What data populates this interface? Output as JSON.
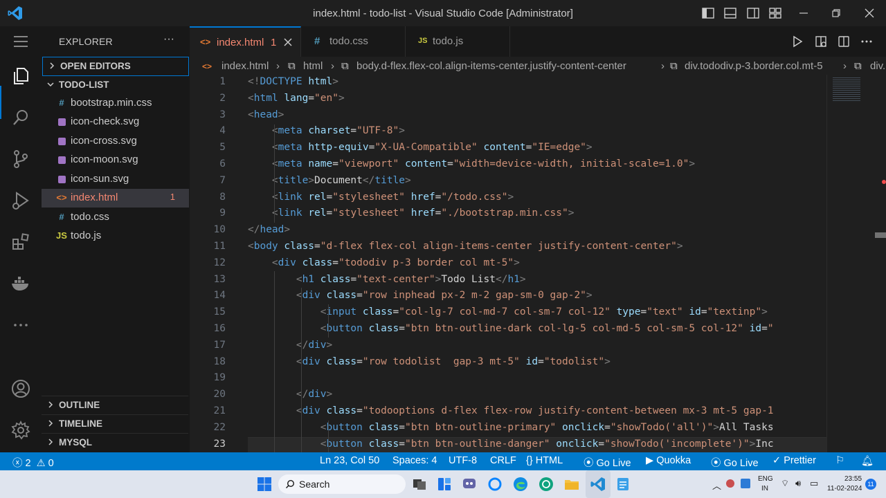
{
  "window": {
    "title": "index.html - todo-list - Visual Studio Code [Administrator]"
  },
  "sidebar": {
    "header": "EXPLORER",
    "more": "···",
    "sections": {
      "open_editors": "OPEN EDITORS",
      "project": "TODO-LIST",
      "outline": "OUTLINE",
      "timeline": "TIMELINE",
      "mysql": "MYSQL"
    },
    "files": [
      {
        "name": "bootstrap.min.css",
        "icon": "css-file-icon"
      },
      {
        "name": "icon-check.svg",
        "icon": "svg-file-icon"
      },
      {
        "name": "icon-cross.svg",
        "icon": "svg-file-icon"
      },
      {
        "name": "icon-moon.svg",
        "icon": "svg-file-icon"
      },
      {
        "name": "icon-sun.svg",
        "icon": "svg-file-icon"
      },
      {
        "name": "index.html",
        "icon": "html-file-icon",
        "errors": "1"
      },
      {
        "name": "todo.css",
        "icon": "css-file-icon"
      },
      {
        "name": "todo.js",
        "icon": "js-file-icon"
      }
    ]
  },
  "tabs": [
    {
      "label": "index.html",
      "badge": "1",
      "icon_text": "<>"
    },
    {
      "label": "todo.css",
      "icon_text": "#"
    },
    {
      "label": "todo.js",
      "icon_text": "JS"
    }
  ],
  "breadcrumb": {
    "file": "index.html",
    "html": "html",
    "body": "body.d-flex.flex-col.align-items-center.justify-content-center",
    "div": "div.tododiv.p-3.border.col.mt-5",
    "more": "div."
  },
  "editor": {
    "lines": [
      {
        "n": "1",
        "code": "<!DOCTYPE html>"
      },
      {
        "n": "2",
        "code": "<html lang=\"en\">"
      },
      {
        "n": "3",
        "code": "<head>"
      },
      {
        "n": "4",
        "code": "    <meta charset=\"UTF-8\">"
      },
      {
        "n": "5",
        "code": "    <meta http-equiv=\"X-UA-Compatible\" content=\"IE=edge\">"
      },
      {
        "n": "6",
        "code": "    <meta name=\"viewport\" content=\"width=device-width, initial-scale=1.0\">"
      },
      {
        "n": "7",
        "code": "    <title>Document</title>"
      },
      {
        "n": "8",
        "code": "    <link rel=\"stylesheet\" href=\"/todo.css\">"
      },
      {
        "n": "9",
        "code": "    <link rel=\"stylesheet\" href=\"./bootstrap.min.css\">"
      },
      {
        "n": "10",
        "code": "</head>"
      },
      {
        "n": "11",
        "code": "<body class=\"d-flex flex-col align-items-center justify-content-center\">"
      },
      {
        "n": "12",
        "code": "    <div class=\"tododiv p-3 border col mt-5\">"
      },
      {
        "n": "13",
        "code": "        <h1 class=\"text-center\">Todo List</h1>"
      },
      {
        "n": "14",
        "code": "        <div class=\"row inphead px-2 m-2 gap-sm-0 gap-2\">"
      },
      {
        "n": "15",
        "code": "            <input class=\"col-lg-7 col-md-7 col-sm-7 col-12\" type=\"text\" id=\"textinp\">"
      },
      {
        "n": "16",
        "code": "            <button class=\"btn btn-outline-dark col-lg-5 col-md-5 col-sm-5 col-12\" id=\""
      },
      {
        "n": "17",
        "code": "        </div>"
      },
      {
        "n": "18",
        "code": "        <div class=\"row todolist  gap-3 mt-5\" id=\"todolist\">"
      },
      {
        "n": "19",
        "code": ""
      },
      {
        "n": "20",
        "code": "        </div>"
      },
      {
        "n": "21",
        "code": "        <div class=\"todooptions d-flex flex-row justify-content-between mx-3 mt-5 gap-1"
      },
      {
        "n": "22",
        "code": "            <button class=\"btn btn-outline-primary\" onclick=\"showTodo('all')\">All Tasks"
      },
      {
        "n": "23",
        "code": "            <button class=\"btn btn-outline-danger\" onclick=\"showTodo('incomplete')\">Inc"
      }
    ]
  },
  "statusbar": {
    "errors": "2",
    "warnings": "0",
    "position": "Ln 23, Col 50",
    "spaces": "Spaces: 4",
    "encoding": "UTF-8",
    "eol": "CRLF",
    "language": "HTML",
    "golive1": "Go Live",
    "quokka": "Quokka",
    "golive2": "Go Live",
    "prettier": "Prettier"
  },
  "taskbar": {
    "search_label": "Search",
    "lang_top": "ENG",
    "lang_bottom": "IN",
    "time": "23:55",
    "date": "11-02-2024",
    "notif_count": "11"
  },
  "colors": {
    "accent": "#0078d4",
    "statusbar": "#007acc",
    "error": "#f48771"
  }
}
